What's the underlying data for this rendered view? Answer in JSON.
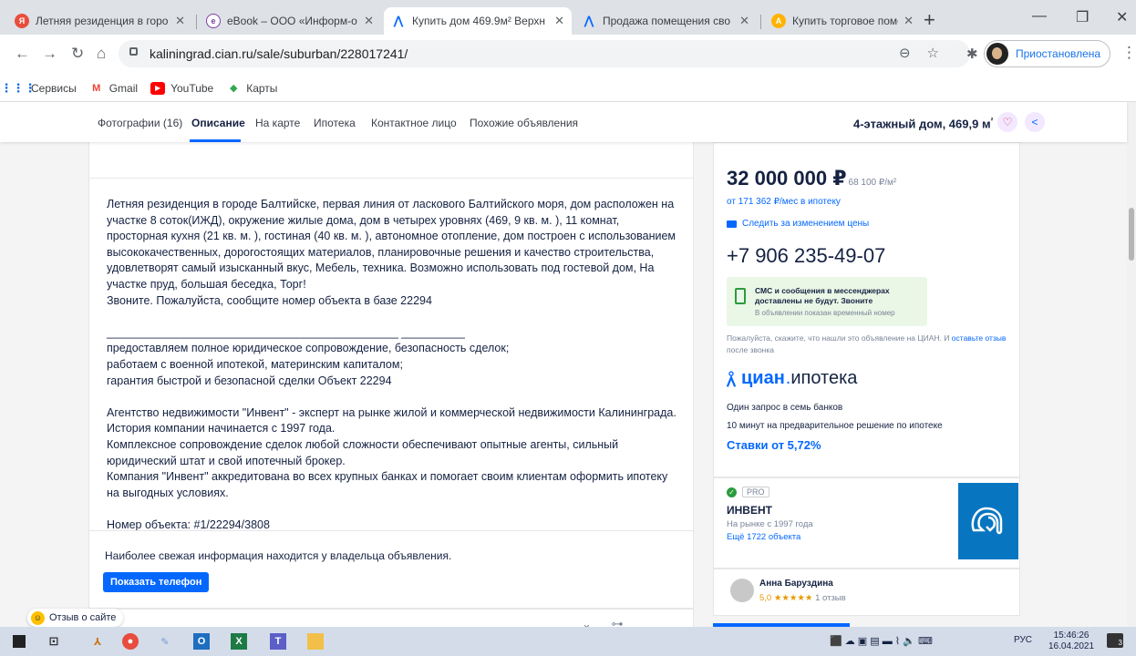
{
  "browser": {
    "tabs": [
      {
        "title": "Летняя резиденция в горо",
        "color": "#e94e3c",
        "glyph": "Я"
      },
      {
        "title": "eBook – ООО «Информ-о",
        "color": "#7b3fa0",
        "glyph": "e"
      },
      {
        "title": "Купить дом 469.9м² Верхн",
        "color": "#0468ff",
        "glyph": "✓"
      },
      {
        "title": "Продажа помещения сво",
        "color": "#0468ff",
        "glyph": "✓"
      },
      {
        "title": "Купить торговое помеще",
        "color": "#ffb300",
        "glyph": "A"
      }
    ],
    "url": "kaliningrad.cian.ru/sale/suburban/228017241/",
    "profile_label": "Приостановлена",
    "bookmarks": [
      "Сервисы",
      "Gmail",
      "YouTube",
      "Карты"
    ]
  },
  "nav": {
    "items": [
      "Фотографии (16)",
      "Описание",
      "На карте",
      "Ипотека",
      "Контактное лицо",
      "Похожие объявления"
    ],
    "title": "4-этажный дом, 469,9 м",
    "title_sup": "²"
  },
  "description": {
    "text": "Летняя резиденция в городе Балтийске, первая линия от ласкового Балтийского моря, дом расположен на участке 8 соток(ИЖД), окружение жилые дома, дом в четырех уровнях (469, 9 кв. м. ), 11 комнат, просторная кухня (21 кв. м. ), гостиная (40 кв. м. ), автономное отопление, дом построен с использованием высококачественных, дорогостоящих материалов, планировочные решения и качество строительства, удовлетворят самый изысканный вкус, Мебель, техника. Возможно использовать под гостевой дом, На участке пруд, большая беседка, Торг!\nЗвоните. Пожалуйста, сообщите номер объекта в базе 22294\n\n______________________________________________ __________\nпредоставляем полное юридическое сопровождение, безопасность сделок;\nработаем с военной ипотекой, материнским капиталом;\nгарантия быстрой и безопасной сделки Объект   22294\n\nАгентство недвижимости \"Инвент\" - эксперт на рынке жилой и коммерческой недвижимости Калининграда. История компании начинается с 1997 года.\nКомплексное сопровождение сделок любой сложности обеспечивают опытные агенты, сильный юридический штат и свой ипотечный брокер.\nКомпания \"Инвент\" аккредитована во всех крупных банках и помогает своим клиентам оформить ипотеку на выгодных условиях.\n\nНомер объекта: #1/22294/3808"
  },
  "owner": {
    "text": "Наиболее свежая информация находится у владельца объявления.",
    "button": "Показать телефон"
  },
  "feedback_label": "Отзыв о сайте",
  "price": {
    "value": "32 000 000 ₽",
    "per_m2": "68 100 ₽/м²",
    "mortgage": "от 171 362 ₽/мес в ипотеку",
    "follow": "Следить за изменением цены",
    "phone": "+7 906 235-49-07",
    "sms_title": "СМС и сообщения в мессенджерах доставлены не будут. Звоните",
    "sms_note": "В объявлении показан временный номер",
    "ask_text": "Пожалуйста, скажите, что нашли это объявление на ЦИАН. И ",
    "ask_link": "оставьте отзыв",
    "ask_tail": " после звонка"
  },
  "cian": {
    "brand": "циан",
    "product": "ипотека",
    "line1": "Один запрос в семь банков",
    "line2": "10 минут на предварительное решение по ипотеке",
    "rates": "Ставки от 5,72%"
  },
  "agent": {
    "badge": "PRO",
    "name": "ИНВЕНТ",
    "since": "На рынке с 1997 года",
    "more": "Ещё 1722 объекта"
  },
  "reviewer": {
    "name": "Анна Баруздина",
    "rating": "5,0",
    "stars": "★★★★★",
    "reviews": "1 отзыв"
  },
  "taskbar": {
    "lang": "РУС",
    "time": "15:46:26",
    "date": "16.04.2021",
    "notif_count": "3"
  }
}
